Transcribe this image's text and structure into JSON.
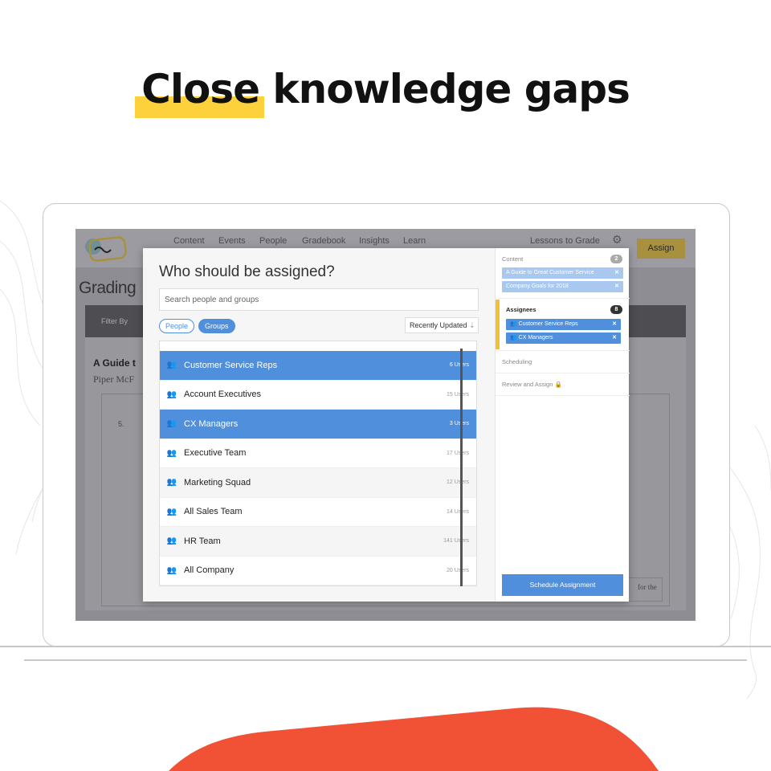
{
  "headline": {
    "highlight": "Close",
    "rest": " knowledge gaps"
  },
  "colors": {
    "accent_yellow": "#fcd13b",
    "primary_blue": "#4f8fdc",
    "blob_orange": "#f15135"
  },
  "app": {
    "nav": [
      "Content",
      "Events",
      "People",
      "Gradebook",
      "Insights",
      "Learn"
    ],
    "lessons_to_grade": "Lessons to Grade",
    "assign_button": "Assign",
    "page_title": "Grading",
    "filter_by": "Filter By",
    "guide_title": "A Guide t",
    "author": "Piper McF",
    "row_number": "5.",
    "snippet": "for the"
  },
  "modal": {
    "title": "Who should be assigned?",
    "search_placeholder": "Search people and groups",
    "tabs": [
      {
        "label": "People",
        "active": false
      },
      {
        "label": "Groups",
        "active": true
      }
    ],
    "sort_label": "Recently Updated",
    "groups": [
      {
        "name": "Customer Service Reps",
        "count": "6 Users",
        "selected": true
      },
      {
        "name": "Account Executives",
        "count": "15 Users",
        "selected": false
      },
      {
        "name": "CX Managers",
        "count": "3 Users",
        "selected": true
      },
      {
        "name": "Executive Team",
        "count": "17 Users",
        "selected": false
      },
      {
        "name": "Marketing Squad",
        "count": "12 Users",
        "selected": false
      },
      {
        "name": "All Sales Team",
        "count": "14 Users",
        "selected": false
      },
      {
        "name": "HR Team",
        "count": "141 Users",
        "selected": false
      },
      {
        "name": "All Company",
        "count": "20 Users",
        "selected": false
      }
    ]
  },
  "side": {
    "content_label": "Content",
    "content_count": "2",
    "content_items": [
      "A Guide to Great Customer Service",
      "Company Goals for 2018"
    ],
    "assignees_label": "Assignees",
    "assignees_count": "8",
    "assignees": [
      "Customer Service Reps",
      "CX Managers"
    ],
    "scheduling": "Scheduling",
    "review": "Review and Assign",
    "schedule_button": "Schedule Assignment"
  }
}
